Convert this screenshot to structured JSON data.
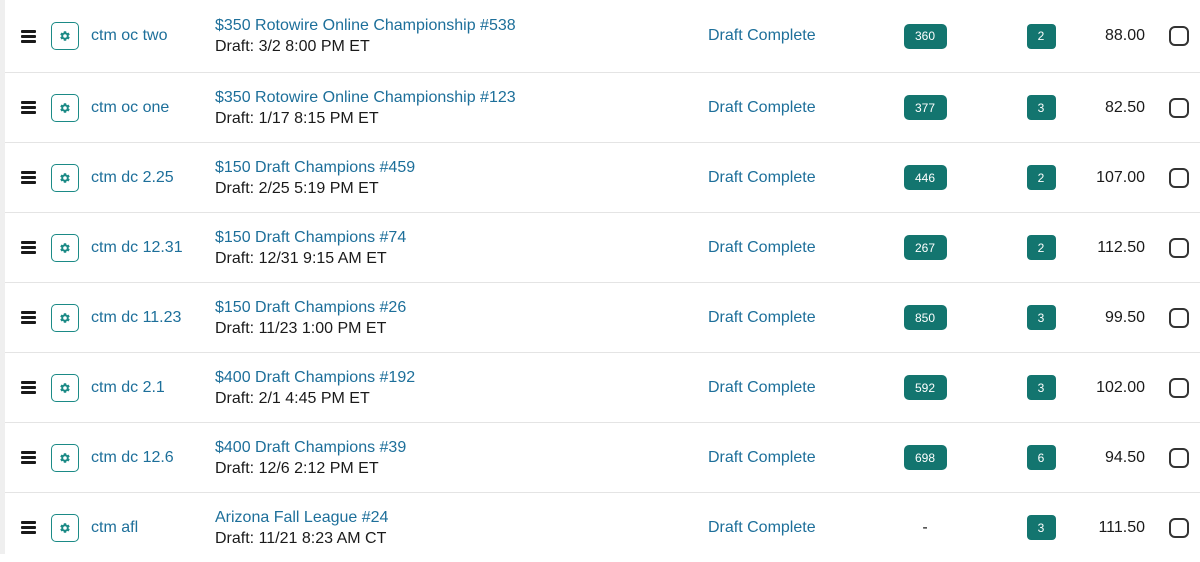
{
  "rows": [
    {
      "team": "ctm oc two",
      "contest": "$350 Rotowire Online Championship #538",
      "draft": "Draft: 3/2 8:00 PM ET",
      "status": "Draft Complete",
      "rank": "360",
      "count": "2",
      "score": "88.00"
    },
    {
      "team": "ctm oc one",
      "contest": "$350 Rotowire Online Championship #123",
      "draft": "Draft: 1/17 8:15 PM ET",
      "status": "Draft Complete",
      "rank": "377",
      "count": "3",
      "score": "82.50"
    },
    {
      "team": "ctm dc 2.25",
      "contest": "$150 Draft Champions #459",
      "draft": "Draft: 2/25 5:19 PM ET",
      "status": "Draft Complete",
      "rank": "446",
      "count": "2",
      "score": "107.00"
    },
    {
      "team": "ctm dc 12.31",
      "contest": "$150 Draft Champions #74",
      "draft": "Draft: 12/31 9:15 AM ET",
      "status": "Draft Complete",
      "rank": "267",
      "count": "2",
      "score": "112.50"
    },
    {
      "team": "ctm dc 11.23",
      "contest": "$150 Draft Champions #26",
      "draft": "Draft: 11/23 1:00 PM ET",
      "status": "Draft Complete",
      "rank": "850",
      "count": "3",
      "score": "99.50"
    },
    {
      "team": "ctm dc 2.1",
      "contest": "$400 Draft Champions #192",
      "draft": "Draft: 2/1 4:45 PM ET",
      "status": "Draft Complete",
      "rank": "592",
      "count": "3",
      "score": "102.00"
    },
    {
      "team": "ctm dc 12.6",
      "contest": "$400 Draft Champions #39",
      "draft": "Draft: 12/6 2:12 PM ET",
      "status": "Draft Complete",
      "rank": "698",
      "count": "6",
      "score": "94.50"
    },
    {
      "team": "ctm afl",
      "contest": "Arizona Fall League #24",
      "draft": "Draft: 11/21 8:23 AM CT",
      "status": "Draft Complete",
      "rank": "-",
      "count": "3",
      "score": "111.50"
    }
  ],
  "icons": {
    "drag": "hamburger-drag-icon",
    "settings": "gear-icon",
    "select": "checkbox"
  },
  "colors": {
    "accent": "#13756f",
    "link": "#1d6f9a",
    "text": "#1a1a1a"
  }
}
